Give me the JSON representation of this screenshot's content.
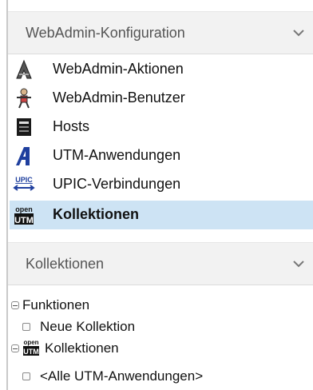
{
  "sections": {
    "config": {
      "title": "WebAdmin-Konfiguration",
      "items": [
        {
          "label": "WebAdmin-Aktionen",
          "icon": "actions-icon"
        },
        {
          "label": "WebAdmin-Benutzer",
          "icon": "user-icon"
        },
        {
          "label": "Hosts",
          "icon": "host-icon"
        },
        {
          "label": "UTM-Anwendungen",
          "icon": "utm-application-icon"
        },
        {
          "label": "UPIC-Verbindungen",
          "icon": "upic-icon"
        },
        {
          "label": "Kollektionen",
          "icon": "openutm-icon",
          "selected": true
        }
      ]
    },
    "collections": {
      "title": "Kollektionen",
      "tree": {
        "functions_label": "Funktionen",
        "new_collection_label": "Neue Kollektion",
        "collections_label": "Kollektionen",
        "all_apps_label": "<Alle UTM-Anwendungen>"
      }
    }
  },
  "colors": {
    "selected_bg": "#cde3f4",
    "header_bg": "#f2f2f2",
    "header_text": "#555555"
  }
}
